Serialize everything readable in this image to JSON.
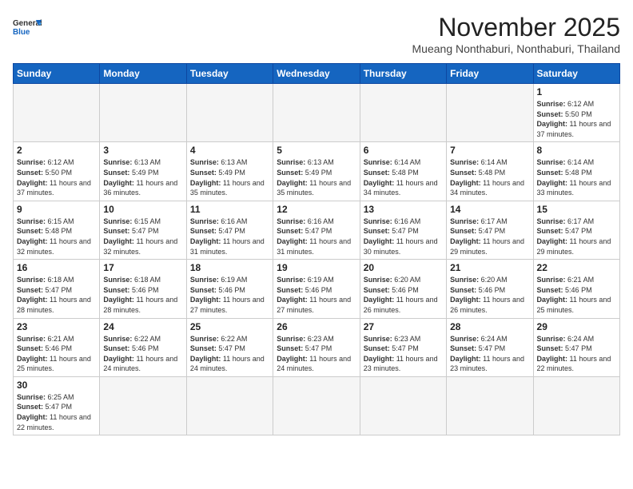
{
  "header": {
    "logo_general": "General",
    "logo_blue": "Blue",
    "month_title": "November 2025",
    "location": "Mueang Nonthaburi, Nonthaburi, Thailand"
  },
  "days_of_week": [
    "Sunday",
    "Monday",
    "Tuesday",
    "Wednesday",
    "Thursday",
    "Friday",
    "Saturday"
  ],
  "weeks": [
    [
      {
        "day": null,
        "empty": true
      },
      {
        "day": null,
        "empty": true
      },
      {
        "day": null,
        "empty": true
      },
      {
        "day": null,
        "empty": true
      },
      {
        "day": null,
        "empty": true
      },
      {
        "day": null,
        "empty": true
      },
      {
        "day": 1,
        "sunrise": "6:12 AM",
        "sunset": "5:50 PM",
        "daylight": "11 hours and 37 minutes."
      }
    ],
    [
      {
        "day": 2,
        "sunrise": "6:12 AM",
        "sunset": "5:50 PM",
        "daylight": "11 hours and 37 minutes."
      },
      {
        "day": 3,
        "sunrise": "6:13 AM",
        "sunset": "5:49 PM",
        "daylight": "11 hours and 36 minutes."
      },
      {
        "day": 4,
        "sunrise": "6:13 AM",
        "sunset": "5:49 PM",
        "daylight": "11 hours and 35 minutes."
      },
      {
        "day": 5,
        "sunrise": "6:13 AM",
        "sunset": "5:49 PM",
        "daylight": "11 hours and 35 minutes."
      },
      {
        "day": 6,
        "sunrise": "6:14 AM",
        "sunset": "5:48 PM",
        "daylight": "11 hours and 34 minutes."
      },
      {
        "day": 7,
        "sunrise": "6:14 AM",
        "sunset": "5:48 PM",
        "daylight": "11 hours and 34 minutes."
      },
      {
        "day": 8,
        "sunrise": "6:14 AM",
        "sunset": "5:48 PM",
        "daylight": "11 hours and 33 minutes."
      }
    ],
    [
      {
        "day": 9,
        "sunrise": "6:15 AM",
        "sunset": "5:48 PM",
        "daylight": "11 hours and 32 minutes."
      },
      {
        "day": 10,
        "sunrise": "6:15 AM",
        "sunset": "5:47 PM",
        "daylight": "11 hours and 32 minutes."
      },
      {
        "day": 11,
        "sunrise": "6:16 AM",
        "sunset": "5:47 PM",
        "daylight": "11 hours and 31 minutes."
      },
      {
        "day": 12,
        "sunrise": "6:16 AM",
        "sunset": "5:47 PM",
        "daylight": "11 hours and 31 minutes."
      },
      {
        "day": 13,
        "sunrise": "6:16 AM",
        "sunset": "5:47 PM",
        "daylight": "11 hours and 30 minutes."
      },
      {
        "day": 14,
        "sunrise": "6:17 AM",
        "sunset": "5:47 PM",
        "daylight": "11 hours and 29 minutes."
      },
      {
        "day": 15,
        "sunrise": "6:17 AM",
        "sunset": "5:47 PM",
        "daylight": "11 hours and 29 minutes."
      }
    ],
    [
      {
        "day": 16,
        "sunrise": "6:18 AM",
        "sunset": "5:47 PM",
        "daylight": "11 hours and 28 minutes."
      },
      {
        "day": 17,
        "sunrise": "6:18 AM",
        "sunset": "5:46 PM",
        "daylight": "11 hours and 28 minutes."
      },
      {
        "day": 18,
        "sunrise": "6:19 AM",
        "sunset": "5:46 PM",
        "daylight": "11 hours and 27 minutes."
      },
      {
        "day": 19,
        "sunrise": "6:19 AM",
        "sunset": "5:46 PM",
        "daylight": "11 hours and 27 minutes."
      },
      {
        "day": 20,
        "sunrise": "6:20 AM",
        "sunset": "5:46 PM",
        "daylight": "11 hours and 26 minutes."
      },
      {
        "day": 21,
        "sunrise": "6:20 AM",
        "sunset": "5:46 PM",
        "daylight": "11 hours and 26 minutes."
      },
      {
        "day": 22,
        "sunrise": "6:21 AM",
        "sunset": "5:46 PM",
        "daylight": "11 hours and 25 minutes."
      }
    ],
    [
      {
        "day": 23,
        "sunrise": "6:21 AM",
        "sunset": "5:46 PM",
        "daylight": "11 hours and 25 minutes."
      },
      {
        "day": 24,
        "sunrise": "6:22 AM",
        "sunset": "5:46 PM",
        "daylight": "11 hours and 24 minutes."
      },
      {
        "day": 25,
        "sunrise": "6:22 AM",
        "sunset": "5:47 PM",
        "daylight": "11 hours and 24 minutes."
      },
      {
        "day": 26,
        "sunrise": "6:23 AM",
        "sunset": "5:47 PM",
        "daylight": "11 hours and 24 minutes."
      },
      {
        "day": 27,
        "sunrise": "6:23 AM",
        "sunset": "5:47 PM",
        "daylight": "11 hours and 23 minutes."
      },
      {
        "day": 28,
        "sunrise": "6:24 AM",
        "sunset": "5:47 PM",
        "daylight": "11 hours and 23 minutes."
      },
      {
        "day": 29,
        "sunrise": "6:24 AM",
        "sunset": "5:47 PM",
        "daylight": "11 hours and 22 minutes."
      }
    ],
    [
      {
        "day": 30,
        "sunrise": "6:25 AM",
        "sunset": "5:47 PM",
        "daylight": "11 hours and 22 minutes."
      },
      {
        "day": null,
        "empty": true
      },
      {
        "day": null,
        "empty": true
      },
      {
        "day": null,
        "empty": true
      },
      {
        "day": null,
        "empty": true
      },
      {
        "day": null,
        "empty": true
      },
      {
        "day": null,
        "empty": true
      }
    ]
  ],
  "labels": {
    "sunrise": "Sunrise: ",
    "sunset": "Sunset: ",
    "daylight": "Daylight: "
  }
}
